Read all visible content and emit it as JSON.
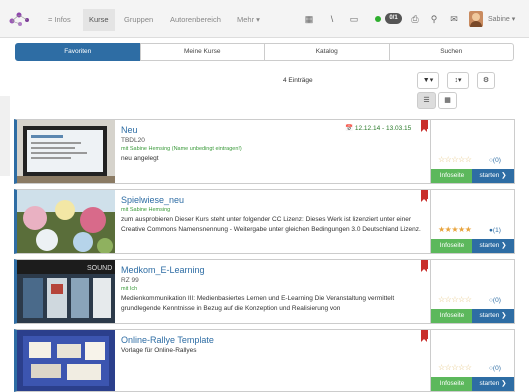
{
  "nav": {
    "infos": "= Infos",
    "kurse": "Kurse",
    "gruppen": "Gruppen",
    "autorenbereich": "Autorenbereich",
    "mehr": "Mehr ▾",
    "badge": "0/1",
    "user": "Sabine ▾"
  },
  "tabs": [
    "Favoriten",
    "Meine Kurse",
    "Katalog",
    "Suchen"
  ],
  "active_tab": "Favoriten",
  "entries_count": "4 Einträge",
  "toolbar": {
    "filter": "▼▾",
    "sort": "↕▾",
    "settings": "⚙"
  },
  "courses": [
    {
      "title": "Neu",
      "code": "TBDL20",
      "owner": "mit Sabine Hemsing (Name unbedingt eintragen!)",
      "desc": "neu angelegt",
      "date": "📅 12.12.14 - 13.03.15",
      "stars": "☆☆☆☆☆",
      "comments": "○(0)",
      "rating": 0
    },
    {
      "title": "Spielwiese_neu",
      "code": "",
      "owner": "mit Sabine Hemsing",
      "desc": "zum ausprobieren Dieser Kurs steht unter folgender CC Lizenz: Dieses Werk ist lizenziert unter einer Creative Commons Namensnennung - Weitergabe unter gleichen Bedingungen 3.0 Deutschland Lizenz.",
      "date": "",
      "stars": "★★★★★",
      "comments": "●(1)",
      "rating": 5
    },
    {
      "title": "Medkom_E-Learning",
      "code": "RZ 99",
      "owner": "mit Ich",
      "desc": "Medienkommunikation III: Medienbasiertes Lernen und E-Learning Die Veranstaltung vermittelt grundlegende Kenntnisse in Bezug auf die Konzeption und Realisierung von",
      "date": "",
      "stars": "☆☆☆☆☆",
      "comments": "○(0)",
      "rating": 0
    },
    {
      "title": "Online-Rallye Template",
      "code": "",
      "owner": "",
      "desc": "Vorlage für Online-Rallyes",
      "date": "",
      "stars": "☆☆☆☆☆",
      "comments": "○(0)",
      "rating": 0
    }
  ],
  "buttons": {
    "info": "Infoseite",
    "start": "starten ❯"
  },
  "colors": {
    "primary": "#2e6da4",
    "success": "#5cb85c",
    "bookmark": "#c9302c"
  }
}
